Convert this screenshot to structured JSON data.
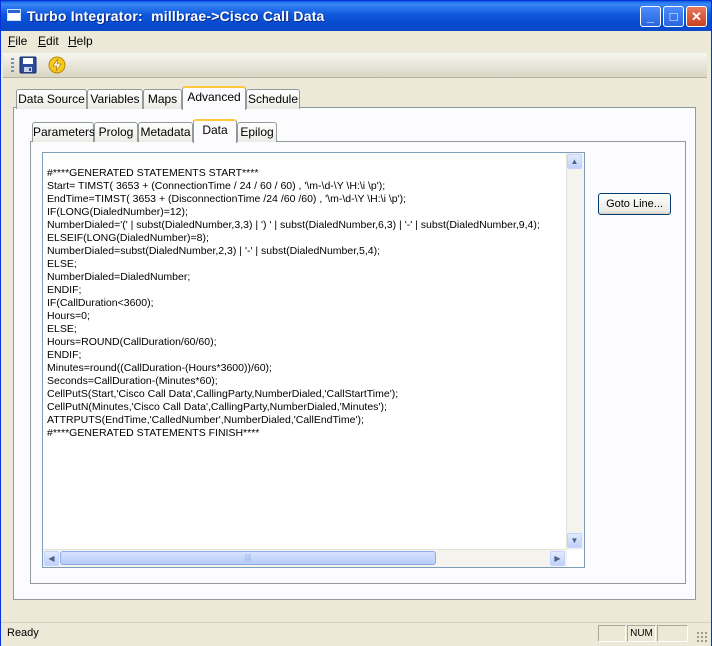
{
  "window": {
    "title": "Turbo Integrator:  millbrae->Cisco Call Data",
    "controls": {
      "minimize": "_",
      "maximize": "□",
      "close": "✕"
    }
  },
  "menu": {
    "items": [
      {
        "label": "File",
        "accel": "F",
        "rest": "ile"
      },
      {
        "label": "Edit",
        "accel": "E",
        "rest": "dit"
      },
      {
        "label": "Help",
        "accel": "H",
        "rest": "elp"
      }
    ]
  },
  "toolbar": {
    "icons": [
      "save-icon",
      "run-icon"
    ]
  },
  "outer_tabs": {
    "items": [
      "Data Source",
      "Variables",
      "Maps",
      "Advanced",
      "Schedule"
    ],
    "active": "Advanced"
  },
  "inner_tabs": {
    "items": [
      "Parameters",
      "Prolog",
      "Metadata",
      "Data",
      "Epilog"
    ],
    "active": "Data"
  },
  "editor": {
    "code": "#****GENERATED STATEMENTS START****\nStart= TIMST( 3653 + (ConnectionTime / 24 / 60 / 60) , '\\m-\\d-\\Y \\H:\\i \\p');\nEndTime=TIMST( 3653 + (DisconnectionTime /24 /60 /60) , '\\m-\\d-\\Y \\H:\\i \\p');\nIF(LONG(DialedNumber)=12);\nNumberDialed='(' | subst(DialedNumber,3,3) | ') ' | subst(DialedNumber,6,3) | '-' | subst(DialedNumber,9,4);\nELSEIF(LONG(DialedNumber)=8);\nNumberDialed=subst(DialedNumber,2,3) | '-' | subst(DialedNumber,5,4);\nELSE;\nNumberDialed=DialedNumber;\nENDIF;\nIF(CallDuration<3600);\nHours=0;\nELSE;\nHours=ROUND(CallDuration/60/60);\nENDIF;\nMinutes=round((CallDuration-(Hours*3600))/60);\nSeconds=CallDuration-(Minutes*60);\nCellPutS(Start,'Cisco Call Data',CallingParty,NumberDialed,'CallStartTime');\nCellPutN(Minutes,'Cisco Call Data',CallingParty,NumberDialed,'Minutes');\nATTRPUTS(EndTime,'CalledNumber',NumberDialed,'CallEndTime');\n#****GENERATED STATEMENTS FINISH****"
  },
  "buttons": {
    "goto_line": "Goto Line..."
  },
  "status": {
    "text": "Ready",
    "panes": [
      "",
      "NUM",
      ""
    ]
  }
}
